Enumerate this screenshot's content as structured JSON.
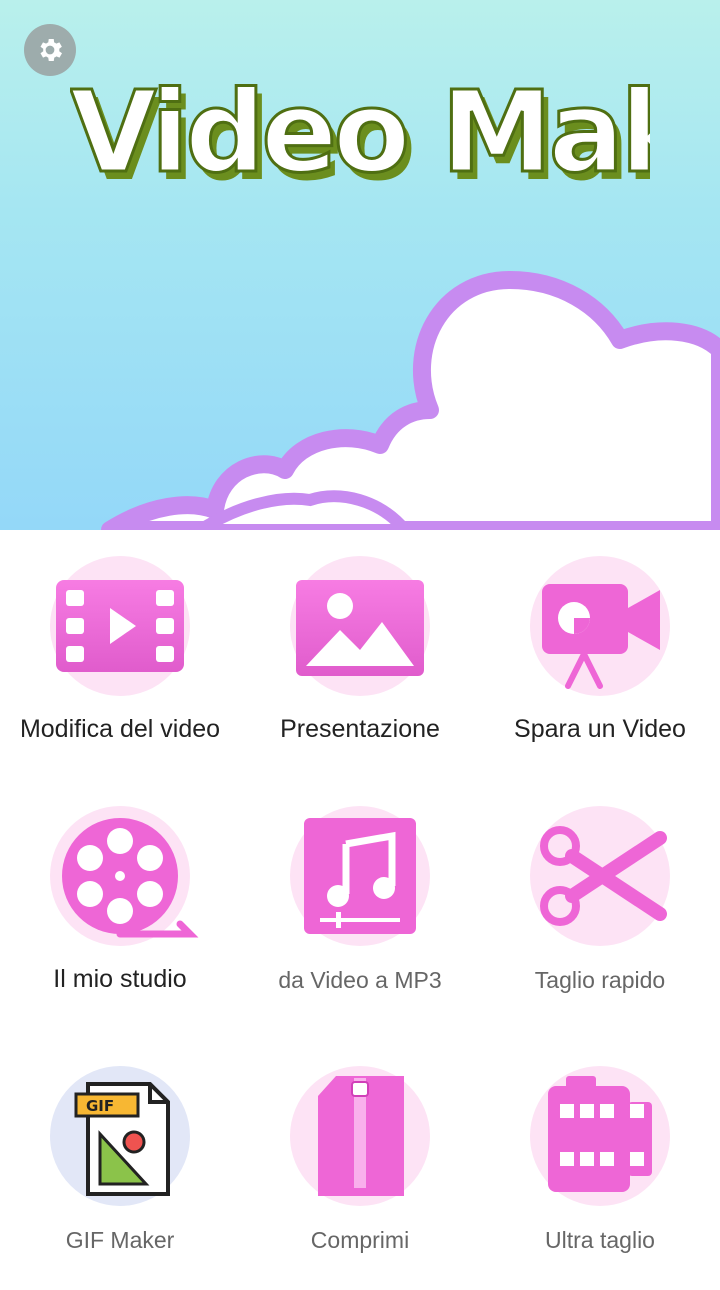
{
  "app": {
    "title": "Video Maker"
  },
  "header": {
    "settings_icon": "gear-icon"
  },
  "colors": {
    "accent": "#ee66d6",
    "accent_dark": "#d13fb9",
    "bubble": "#fde3f5",
    "title_fill": "#ffffff",
    "title_shadow": "#6b8e1e",
    "cloud_outline": "#c78bf0"
  },
  "menu": [
    {
      "label": "Modifica del video",
      "icon": "film-play-icon"
    },
    {
      "label": "Presentazione",
      "icon": "image-landscape-icon"
    },
    {
      "label": "Spara un Video",
      "icon": "video-camera-icon"
    },
    {
      "label": "Il mio studio",
      "icon": "film-reel-icon"
    },
    {
      "label": "da Video a MP3",
      "icon": "music-note-icon"
    },
    {
      "label": "Taglio rapido",
      "icon": "scissors-icon"
    },
    {
      "label": "GIF Maker",
      "icon": "gif-file-icon"
    },
    {
      "label": "Comprimi",
      "icon": "zip-file-icon"
    },
    {
      "label": "Ultra taglio",
      "icon": "film-strip-icon"
    }
  ]
}
